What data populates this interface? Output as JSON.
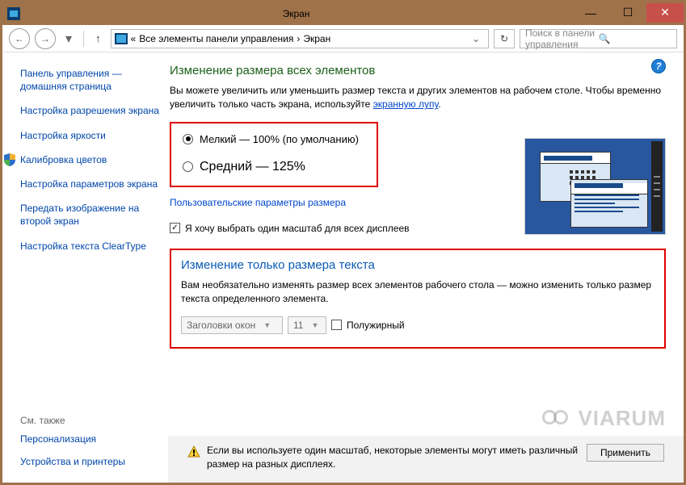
{
  "window": {
    "title": "Экран"
  },
  "nav": {
    "path_prefix": "«",
    "path1": "Все элементы панели управления",
    "sep": "›",
    "path2": "Экран",
    "search_placeholder": "Поиск в панели управления"
  },
  "sidebar": {
    "links": [
      "Панель управления — домашняя страница",
      "Настройка разрешения экрана",
      "Настройка яркости",
      "Калибровка цветов",
      "Настройка параметров экрана",
      "Передать изображение на второй экран",
      "Настройка текста ClearType"
    ],
    "seealso_title": "См. также",
    "seealso": [
      "Персонализация",
      "Устройства и принтеры"
    ]
  },
  "main": {
    "heading1": "Изменение размера всех элементов",
    "desc1a": "Вы можете увеличить или уменьшить размер текста и других элементов на рабочем столе. Чтобы временно увеличить только часть экрана, используйте ",
    "desc1link": "экранную лупу",
    "radio_small": "Мелкий — 100% (по умолчанию)",
    "radio_medium": "Средний — 125%",
    "custom_link": "Пользовательские параметры размера",
    "one_scale": "Я хочу выбрать один масштаб для всех дисплеев",
    "heading2": "Изменение только размера текста",
    "desc2": "Вам необязательно изменять размер всех элементов рабочего стола — можно изменить только размер текста определенного элемента.",
    "dropdown_item": "Заголовки окон",
    "dropdown_size": "11",
    "bold_label": "Полужирный",
    "footer_warn": "Если вы используете один масштаб, некоторые элементы могут иметь различный размер на разных дисплеях.",
    "apply": "Применить"
  },
  "watermark": "VIARUM"
}
